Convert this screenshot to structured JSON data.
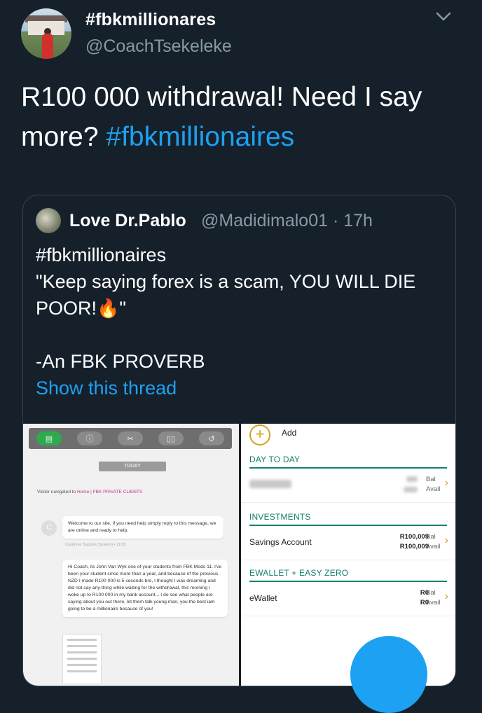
{
  "tweet": {
    "display_name": "#fbkmillionares",
    "handle": "@CoachTsekeleke",
    "text_main": "R100 000 withdrawal! Need I say more? ",
    "text_hashtag": "#fbkmillionaires"
  },
  "quote": {
    "name": "Love Dr.Pablo",
    "handle": "@Madidimalo01 · 17h",
    "line1": "#fbkmillionaires",
    "line2": "\"Keep saying forex is a scam, YOU WILL DIE",
    "line3_a": "POOR!",
    "line3_b": "\"",
    "line4": "-An FBK PROVERB",
    "show_thread": "Show this thread"
  },
  "chat_screen": {
    "today": "TODAY",
    "visitor_prefix": "Visitor navigated to ",
    "visitor_link": "Home | FBK PRIVATE CLIENTS",
    "avatar_letter": "C",
    "welcome": "Welcome to our site, if you need help simply reply to this message, we are online and ready to help.",
    "support_meta": "Customer Support (System) • 11:05",
    "message": "Hi Coach, its John Van Wyk one of your students from FBK Mods 11. I've been your student since more than a year, and because of the previous NZD I made R100 000 is 5 seconds bro, I thought I was dreaming and did not say any-thing while waiting for the withdrawal, this morning I woke up to R100 000 in my bank account... I do see what people are saying about you out there, let them talk young man, you the best iam going to be a millionaire because of you!"
  },
  "bank_screen": {
    "add_label": "Add",
    "sections": [
      {
        "title": "DAY TO DAY"
      },
      {
        "title": "INVESTMENTS"
      },
      {
        "title": "EWALLET + EASY ZERO"
      }
    ],
    "rows": [
      {
        "label": "",
        "bal": "",
        "avail": "",
        "bal_label": "Bal",
        "avail_label": "Avail"
      },
      {
        "label": "Savings Account",
        "bal": "R100,009",
        "avail": "R100,009",
        "bal_label": "Bal",
        "avail_label": "Avail"
      },
      {
        "label": "eWallet",
        "bal": "R0",
        "avail": "R0",
        "bal_label": "Bal",
        "avail_label": "Avail"
      }
    ]
  },
  "colors": {
    "background": "#15202b",
    "link_blue": "#1da1f2",
    "muted": "#8899a6",
    "bank_green": "#14806d",
    "bank_gold": "#d4a21a"
  }
}
